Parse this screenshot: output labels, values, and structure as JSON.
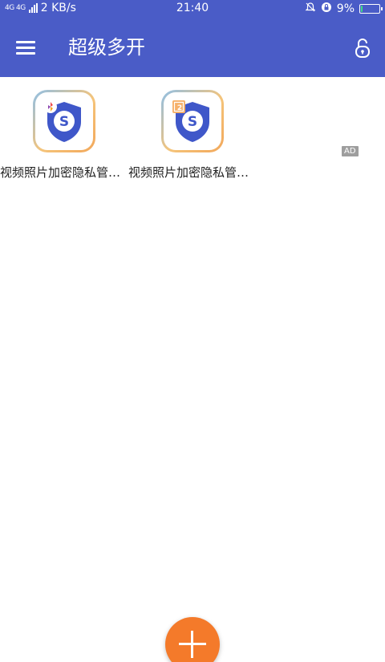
{
  "status_bar": {
    "network": "4G 4G",
    "speed": "2 KB/s",
    "time": "21:40",
    "battery_percent": "9%",
    "battery_level": 0.09,
    "icons": [
      "signal-icon",
      "bell-off-icon",
      "rotation-lock-icon",
      "battery-charging-icon"
    ]
  },
  "app_bar": {
    "title": "超级多开",
    "icons": [
      "menu-icon",
      "unlock-icon"
    ],
    "color": "#4a5cc7"
  },
  "apps": [
    {
      "label": "视频照片加密隐私管…",
      "badge": "multi-color-badge-icon"
    },
    {
      "label": "视频照片加密隐私管…",
      "badge": "clone-2-badge-icon",
      "badge_text": "2"
    }
  ],
  "ad": {
    "label": "AD"
  },
  "fab": {
    "icon": "plus-icon",
    "color": "#f47a2a"
  }
}
